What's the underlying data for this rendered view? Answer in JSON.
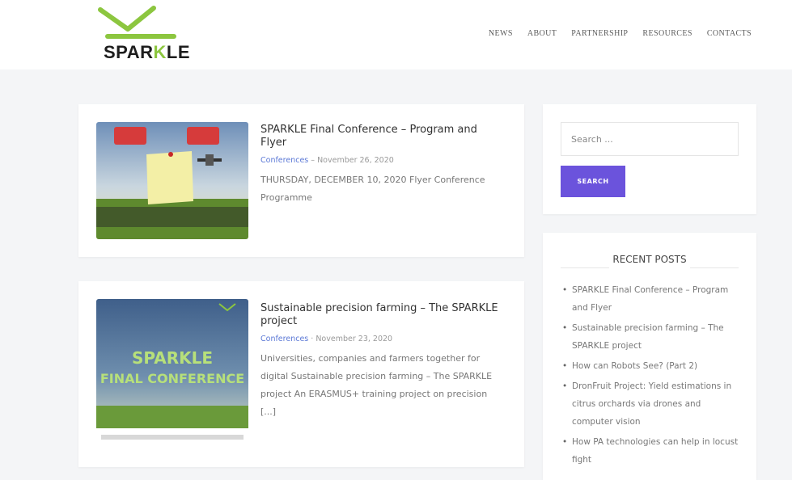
{
  "brand": {
    "logo_text_pre": "SPAR",
    "logo_text_k": "K",
    "logo_text_post": "LE",
    "accent": "#8cc63f"
  },
  "nav": [
    "NEWS",
    "ABOUT",
    "PARTNERSHIP",
    "RESOURCES",
    "CONTACTS"
  ],
  "posts": [
    {
      "title": "SPARKLE Final Conference – Program and Flyer",
      "category": "Conferences",
      "date": "November 26, 2020",
      "excerpt": "THURSDAY, DECEMBER 10, 2020 Flyer Conference Programme"
    },
    {
      "title": "Sustainable precision farming – The SPARKLE project",
      "category": "Conferences",
      "date": "November 23, 2020",
      "excerpt": "Universities, companies and farmers together for digital Sustainable precision farming – The SPARKLE project An ERASMUS+ training project on precision [...]",
      "thumb_text_1": "SPARKLE",
      "thumb_text_2": "FINAL CONFERENCE"
    }
  ],
  "search": {
    "placeholder": "Search ...",
    "button_label": "SEARCH",
    "button_color": "#6b53dc"
  },
  "recent": {
    "heading": "RECENT POSTS",
    "items": [
      "SPARKLE Final Conference – Program and Flyer",
      "Sustainable precision farming – The SPARKLE project",
      "How can Robots See? (Part 2)",
      "DronFruit Project: Yield estimations in citrus orchards via drones and computer vision",
      "How PA technologies can help in locust fight"
    ]
  }
}
